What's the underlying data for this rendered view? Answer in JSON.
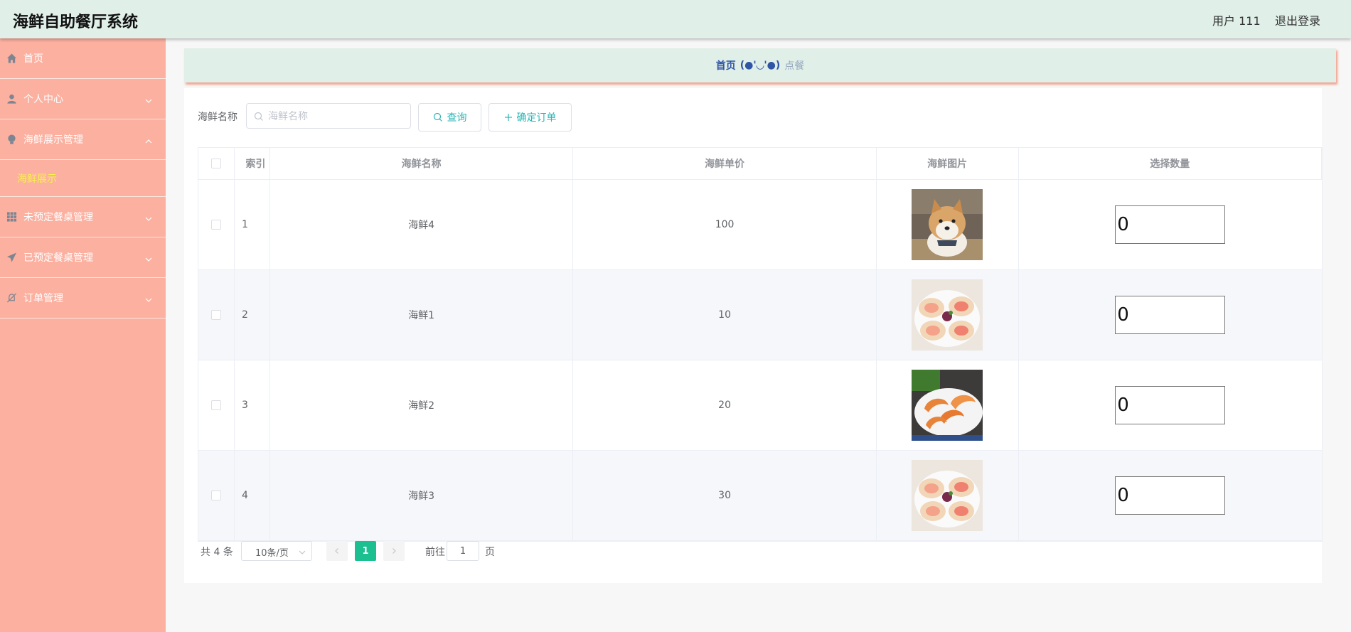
{
  "header": {
    "title": "海鲜自助餐厅系统",
    "user_label": "用户 111",
    "logout_label": "退出登录"
  },
  "sidebar": {
    "items": [
      {
        "label": "首页",
        "icon": "home-icon"
      },
      {
        "label": "个人中心",
        "icon": "user-icon",
        "expandable": true
      },
      {
        "label": "海鲜展示管理",
        "icon": "bulb-icon",
        "expandable": true,
        "expanded": true,
        "children": [
          {
            "label": "海鲜展示",
            "active": true
          }
        ]
      },
      {
        "label": "未预定餐桌管理",
        "icon": "grid-icon",
        "expandable": true
      },
      {
        "label": "已预定餐桌管理",
        "icon": "send-icon",
        "expandable": true
      },
      {
        "label": "订单管理",
        "icon": "bell-off-icon",
        "expandable": true
      }
    ],
    "colors": {
      "background": "#fcb0a0",
      "active_text": "#f8f24a"
    }
  },
  "breadcrumb": {
    "home": "首页",
    "emoji": "(●'◡'●)",
    "current": "点餐"
  },
  "search": {
    "label": "海鲜名称",
    "placeholder": "海鲜名称",
    "value": "",
    "search_button": "查询",
    "confirm_button": "确定订单"
  },
  "table": {
    "columns": [
      "索引",
      "海鲜名称",
      "海鲜单价",
      "海鲜图片",
      "选择数量"
    ],
    "rows": [
      {
        "index": "1",
        "name": "海鲜4",
        "price": "100",
        "image": "shiba-dog-photo",
        "quantity": "0"
      },
      {
        "index": "2",
        "name": "海鲜1",
        "price": "10",
        "image": "scallops-photo",
        "quantity": "0"
      },
      {
        "index": "3",
        "name": "海鲜2",
        "price": "20",
        "image": "shrimp-photo",
        "quantity": "0"
      },
      {
        "index": "4",
        "name": "海鲜3",
        "price": "30",
        "image": "scallops-photo",
        "quantity": "0"
      }
    ]
  },
  "pagination": {
    "total_text": "共 4 条",
    "page_size": "10条/页",
    "current_page": "1",
    "goto_label": "前往",
    "goto_value": "1",
    "goto_unit": "页"
  },
  "colors": {
    "header_bg": "#e0efe8",
    "accent": "#2ab5b5",
    "page_active": "#1cbf8f",
    "breadcrumb_link": "#2f55a4"
  }
}
